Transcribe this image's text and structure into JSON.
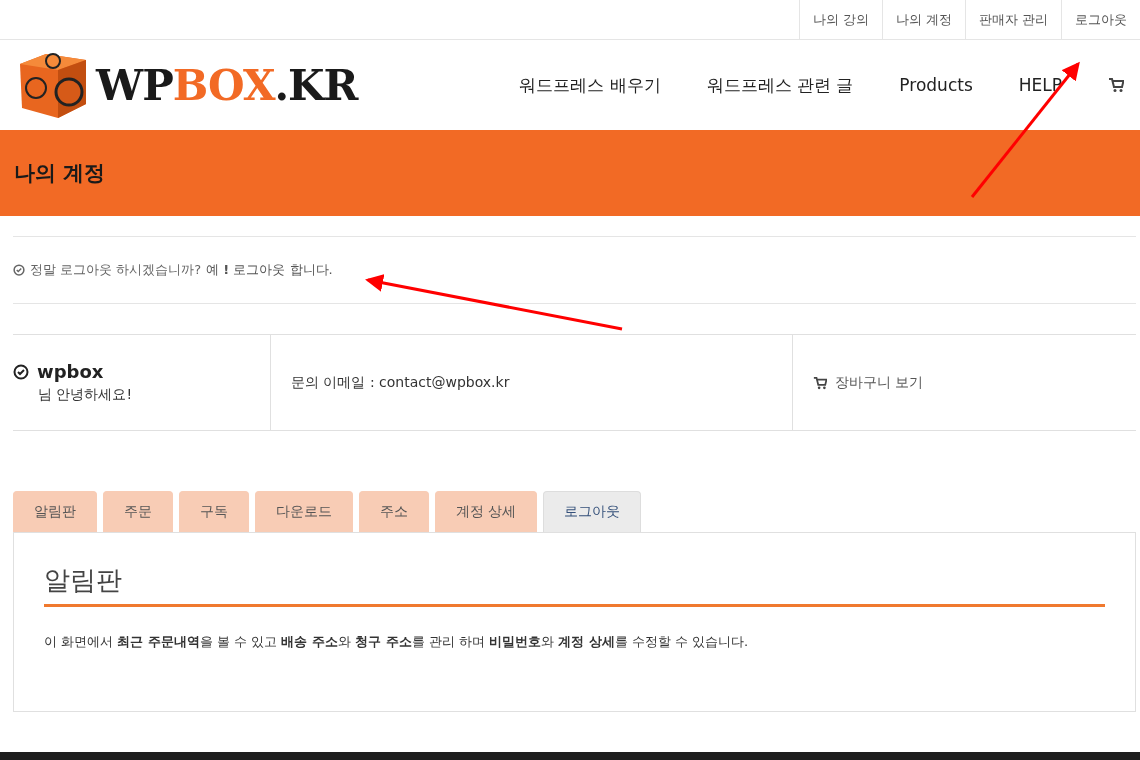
{
  "top_links": [
    {
      "label": "나의 강의"
    },
    {
      "label": "나의 계정"
    },
    {
      "label": "판매자 관리"
    },
    {
      "label": "로그아웃"
    }
  ],
  "logo": [
    {
      "text": "WP",
      "accent": false
    },
    {
      "text": "BOX",
      "accent": true
    },
    {
      "text": ".KR",
      "accent": false
    }
  ],
  "nav": [
    {
      "label": "워드프레스 배우기"
    },
    {
      "label": "워드프레스 관련 글"
    },
    {
      "label": "Products"
    },
    {
      "label": "HELP"
    }
  ],
  "page_title": "나의 계정",
  "notice": {
    "text": "정말 로그아웃 하시겠습니까?",
    "link": "예 **!** 로그아웃 합니다."
  },
  "account": {
    "username": "wpbox",
    "greeting": "님 안녕하세요!",
    "email": "문의 이메일 : contact@wpbox.kr",
    "cart": "장바구니 보기"
  },
  "tabs": [
    {
      "label": "알림판",
      "selected": false
    },
    {
      "label": "주문",
      "selected": false
    },
    {
      "label": "구독",
      "selected": false
    },
    {
      "label": "다운로드",
      "selected": false
    },
    {
      "label": "주소",
      "selected": false
    },
    {
      "label": "계정 상세",
      "selected": false
    },
    {
      "label": "로그아웃",
      "selected": true
    }
  ],
  "panel": {
    "heading": "알림판",
    "description": "이 화면에서 **최근 주문내역**을 볼 수 있고 **배송 주소**와 **청구 주소**를 관리 하며 **비밀번호**와 **계정 상세**를 수정할 수 있습니다."
  }
}
